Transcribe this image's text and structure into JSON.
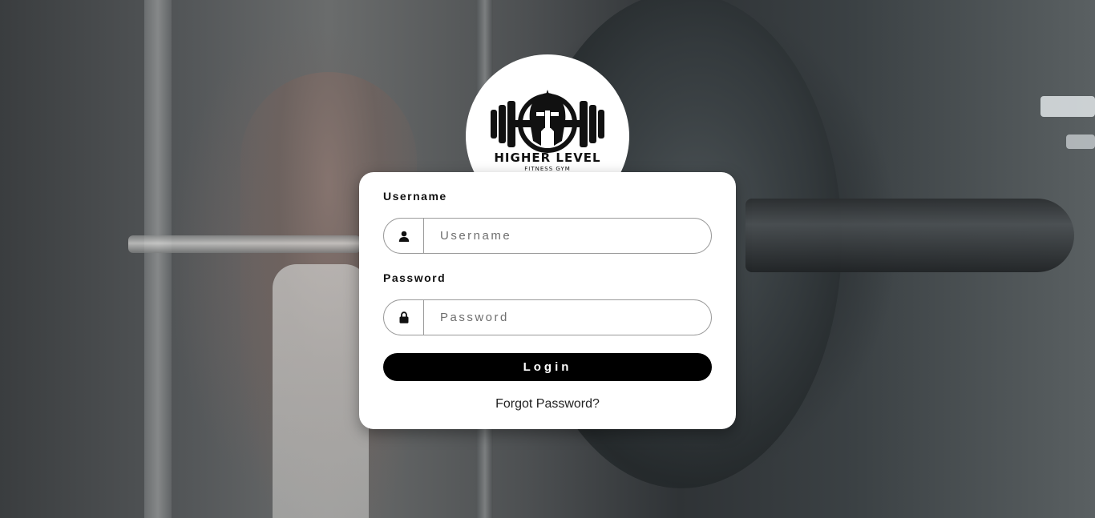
{
  "logo": {
    "title": "HIGHER LEVEL",
    "subtitle": "FITNESS GYM",
    "icon": "spartan-helmet-barbell-icon"
  },
  "form": {
    "username_label": "Username",
    "username_placeholder": "Username",
    "username_value": "",
    "username_icon": "user-icon",
    "password_label": "Password",
    "password_placeholder": "Password",
    "password_value": "",
    "password_icon": "lock-icon",
    "login_label": "Login",
    "forgot_label": "Forgot Password?"
  },
  "colors": {
    "button": "#000000",
    "card": "#ffffff",
    "border": "#9a9a9a"
  }
}
